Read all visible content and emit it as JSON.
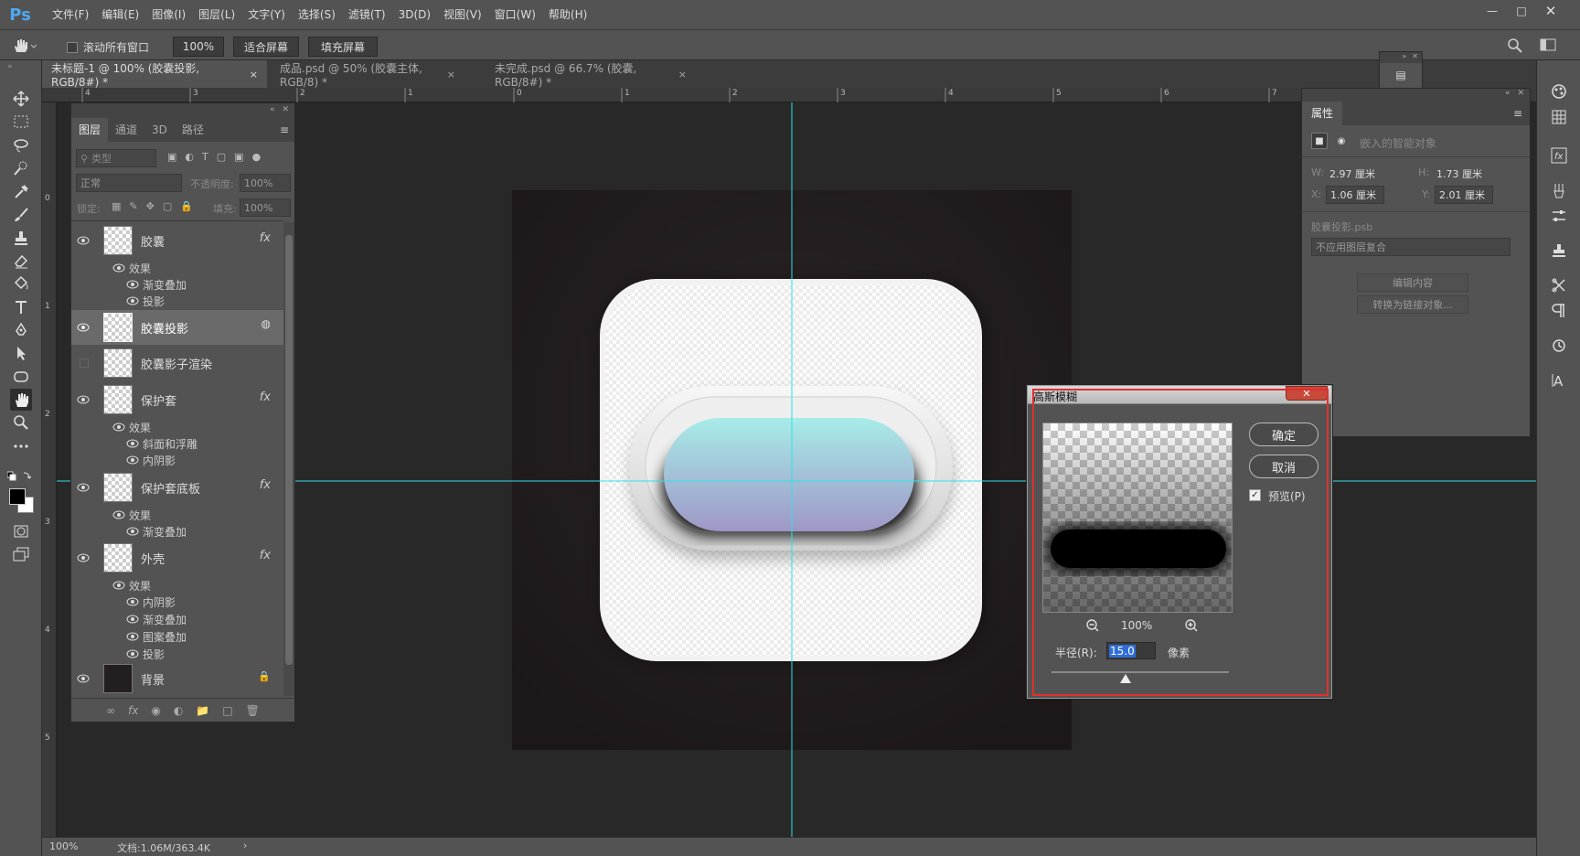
{
  "app": {
    "logo": "Ps"
  },
  "menu": [
    "文件(F)",
    "编辑(E)",
    "图像(I)",
    "图层(L)",
    "文字(Y)",
    "选择(S)",
    "滤镜(T)",
    "3D(D)",
    "视图(V)",
    "窗口(W)",
    "帮助(H)"
  ],
  "options": {
    "scroll_all": "滚动所有窗口",
    "zoom": "100%",
    "fit_screen": "适合屏幕",
    "fill_screen": "填充屏幕"
  },
  "tabs": [
    {
      "label": "未标题-1 @ 100% (胶囊投影, RGB/8#) *",
      "close": "×"
    },
    {
      "label": "成品.psd @ 50% (胶囊主体, RGB/8) *",
      "close": "×"
    },
    {
      "label": "未完成.psd @ 66.7% (胶囊, RGB/8#) *",
      "close": "×"
    }
  ],
  "ruler_h": [
    "4",
    "3",
    "2",
    "1",
    "0",
    "1",
    "2",
    "3",
    "4",
    "5",
    "6",
    "7"
  ],
  "ruler_v": [
    "0",
    "1",
    "2",
    "3",
    "4",
    "5"
  ],
  "layers_panel": {
    "tabs": [
      "图层",
      "通道",
      "3D",
      "路径"
    ],
    "filter_placeholder": "类型",
    "blend_mode": "正常",
    "opacity_label": "不透明度:",
    "opacity_value": "100%",
    "lock_label": "锁定:",
    "fill_label": "填充:",
    "fill_value": "100%",
    "effects_word": "效果",
    "fx": "fx",
    "layers": [
      {
        "name": "胶囊",
        "effects": [
          "渐变叠加",
          "投影"
        ]
      },
      {
        "name": "胶囊投影"
      },
      {
        "name": "胶囊影子渲染"
      },
      {
        "name": "保护套",
        "effects": [
          "斜面和浮雕",
          "内阴影"
        ]
      },
      {
        "name": "保护套底板",
        "effects": [
          "渐变叠加"
        ]
      },
      {
        "name": "外壳",
        "effects": [
          "内阴影",
          "渐变叠加",
          "图案叠加",
          "投影"
        ]
      },
      {
        "name": "背景"
      }
    ]
  },
  "properties_panel": {
    "title": "属性",
    "type": "嵌入的智能对象",
    "w_label": "W:",
    "w_value": "2.97 厘米",
    "h_label": "H:",
    "h_value": "1.73 厘米",
    "x_label": "X:",
    "x_value": "1.06 厘米",
    "y_label": "Y:",
    "y_value": "2.01 厘米",
    "file": "胶囊投影.psb",
    "comp": "不应用图层复合",
    "edit_btn": "编辑内容",
    "convert_btn": "转换为链接对象..."
  },
  "dialog": {
    "title": "高斯模糊",
    "ok": "确定",
    "cancel": "取消",
    "preview_label": "预览(P)",
    "preview_checked": true,
    "zoom": "100%",
    "radius_label": "半径(R):",
    "radius_value": "15.0",
    "unit": "像素",
    "slider_fraction": 0.42
  },
  "status": {
    "zoom": "100%",
    "doc": "文档:1.06M/363.4K",
    "arrow": "›"
  },
  "colors": {
    "guide": "#2fe0e6",
    "accent": "#e03030",
    "capsule_top": "#a7ece8",
    "capsule_bottom": "#9f97c7"
  }
}
